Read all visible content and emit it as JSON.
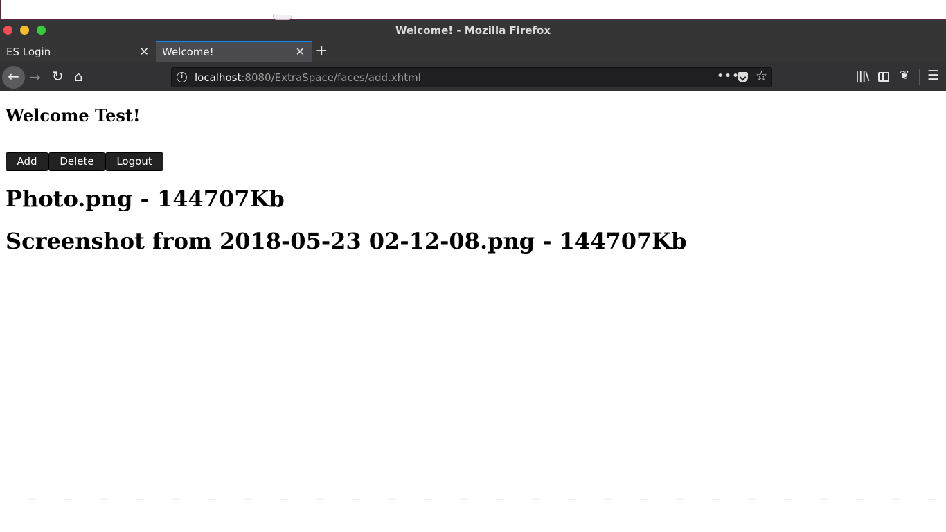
{
  "window": {
    "title": "Welcome! - Mozilla Firefox"
  },
  "tabs": [
    {
      "label": "ES Login",
      "active": false
    },
    {
      "label": "Welcome!",
      "active": true
    }
  ],
  "tab_close_glyph": "✕",
  "new_tab_glyph": "+",
  "toolbar": {
    "back_icon": "back-arrow-icon",
    "forward_icon": "forward-arrow-icon",
    "reload_icon": "reload-icon",
    "home_icon": "home-icon",
    "more_glyph": "•••"
  },
  "url": {
    "host": "localhost",
    "rest": ":8080/ExtraSpace/faces/add.xhtml"
  },
  "page": {
    "welcome": "Welcome Test!",
    "buttons": {
      "add": "Add",
      "delete": "Delete",
      "logout": "Logout"
    },
    "files": [
      "Photo.png - 144707Kb",
      "Screenshot from 2018-05-23 02-12-08.png - 144707Kb"
    ]
  },
  "colors": {
    "titlebar": "#353535",
    "active_tab_accent": "#0a84ff",
    "button_bg": "#222222"
  }
}
